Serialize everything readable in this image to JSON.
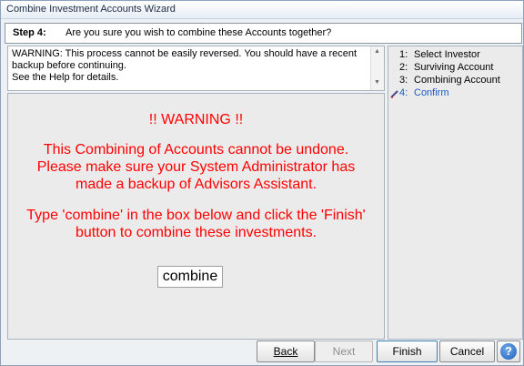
{
  "window": {
    "title": "Combine Investment Accounts Wizard"
  },
  "step": {
    "label": "Step 4:",
    "question": "Are you sure you wish to combine these Accounts together?"
  },
  "warning_box": {
    "line1": "WARNING:  This process cannot be easily reversed. You should have a recent",
    "line2": "backup before continuing.",
    "line3": "See the Help for details."
  },
  "main": {
    "heading": "!! WARNING !!",
    "line1": "This Combining of Accounts cannot be undone.",
    "line2": "Please make sure your System Administrator has",
    "line3": "made a backup of Advisors Assistant.",
    "line4": "Type 'combine' in the box below and click the 'Finish'",
    "line5": "button to combine these investments.",
    "input_value": "combine"
  },
  "steps": [
    {
      "num": "1:",
      "label": "Select Investor"
    },
    {
      "num": "2:",
      "label": "Surviving Account"
    },
    {
      "num": "3:",
      "label": "Combining Account"
    },
    {
      "num": "4:",
      "label": "Confirm"
    }
  ],
  "buttons": {
    "back": "Back",
    "next": "Next",
    "finish": "Finish",
    "cancel": "Cancel",
    "help": "?"
  },
  "colors": {
    "warning_text": "#ff0000",
    "active_step": "#1e57c7"
  }
}
